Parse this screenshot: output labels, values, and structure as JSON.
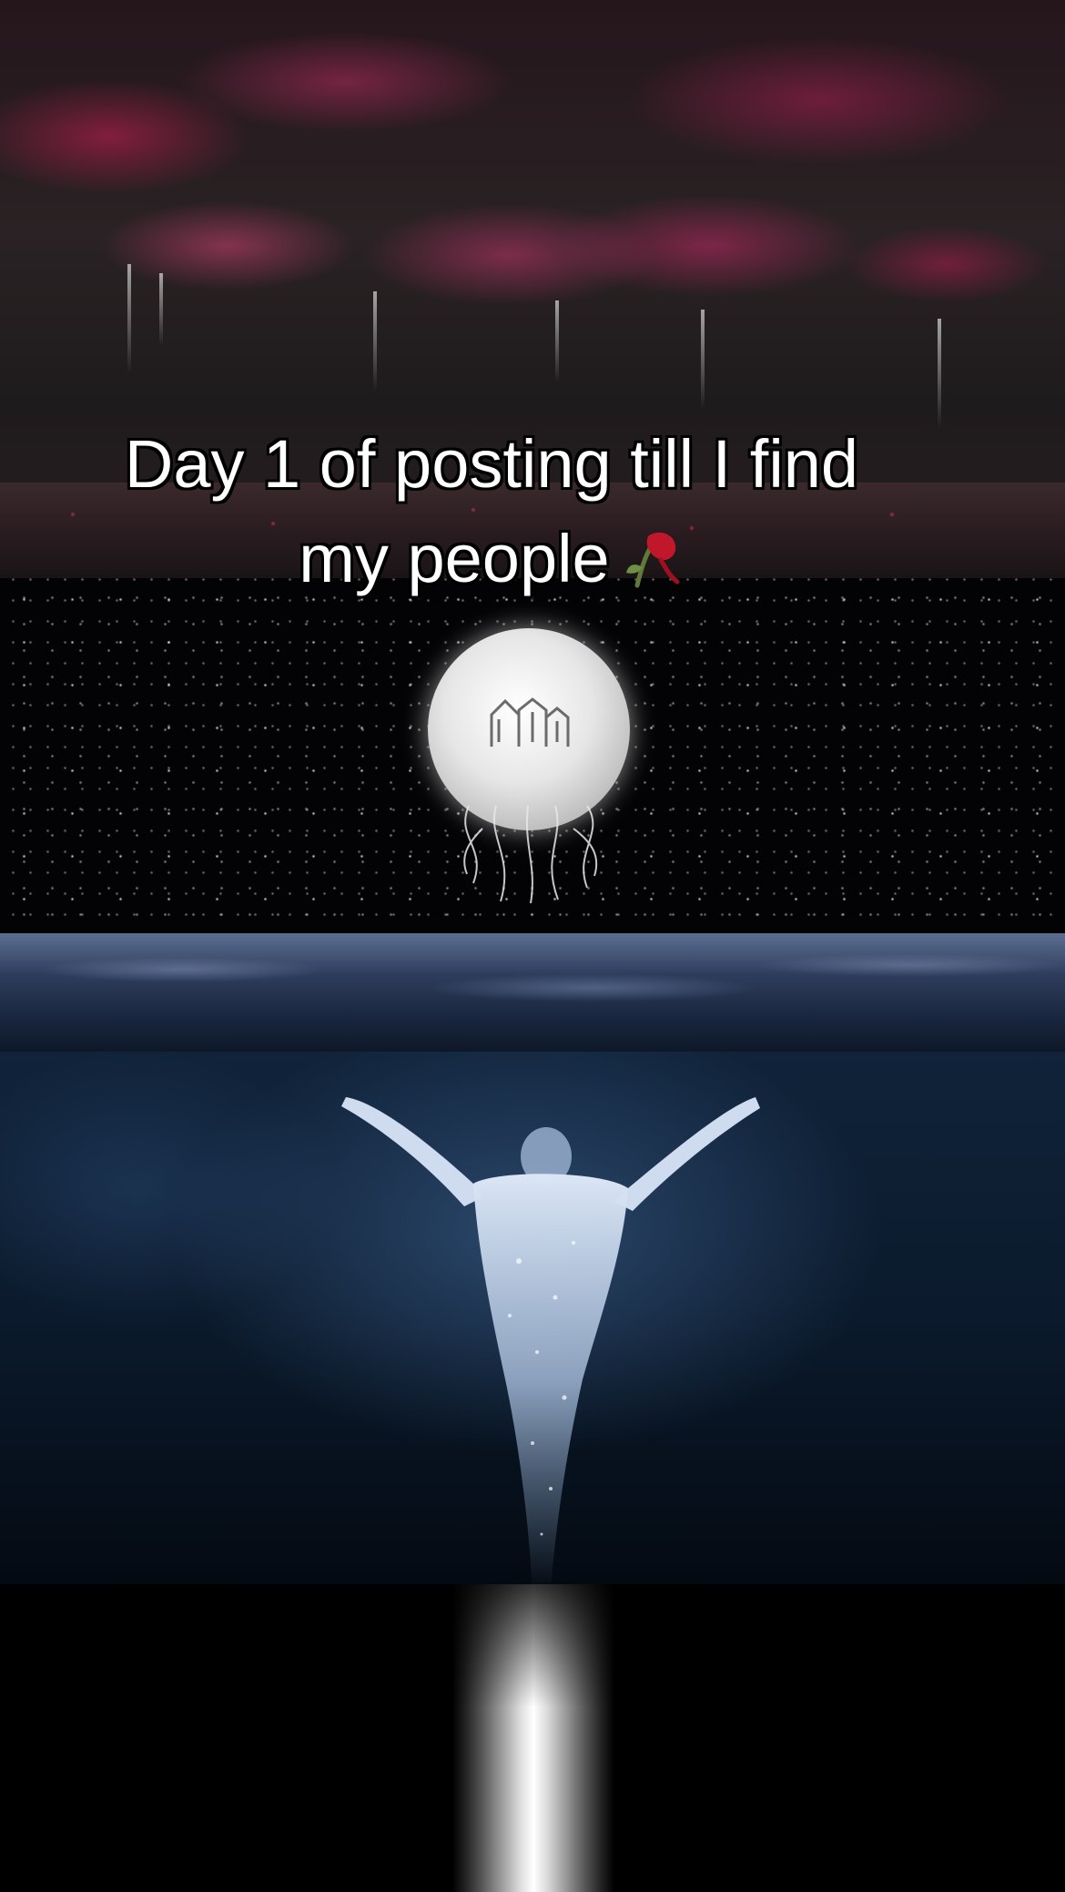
{
  "caption": {
    "line1": "Day 1 of posting till I find",
    "line2": "my people",
    "emoji_icon": "wilted-rose-icon"
  },
  "colors": {
    "caption_text": "#ffffff",
    "caption_outline": "#000000",
    "foliage_accent": "#b0304a",
    "water_accent": "#3c5f8c"
  }
}
